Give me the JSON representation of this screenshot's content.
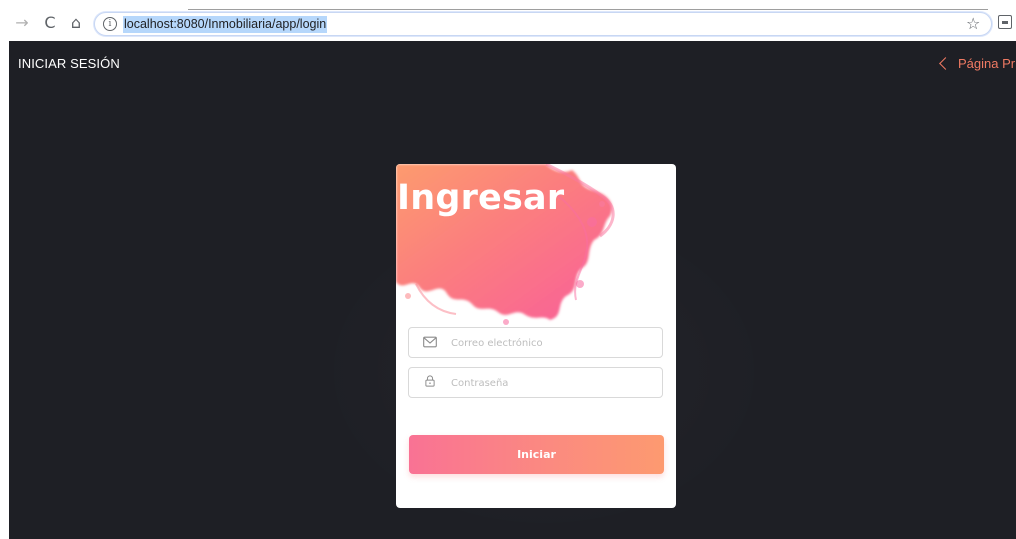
{
  "browser": {
    "url": "localhost:8080/Inmobiliaria/app/login",
    "icons": {
      "back": "arrow-right-icon",
      "reload": "reload-icon",
      "home": "home-icon",
      "info": "info-icon",
      "bookmark": "star-icon",
      "extension": "cast-icon"
    }
  },
  "header": {
    "title": "INICIAR SESIÓN",
    "back_link": "Página Pri"
  },
  "login": {
    "title": "Ingresar",
    "email_placeholder": "Correo electrónico",
    "password_placeholder": "Contraseña",
    "submit_label": "Iniciar"
  },
  "colors": {
    "page_background": "#1e1f25",
    "accent": "#f07a63",
    "button_gradient_start": "#f97294",
    "button_gradient_end": "#fd9a70"
  }
}
